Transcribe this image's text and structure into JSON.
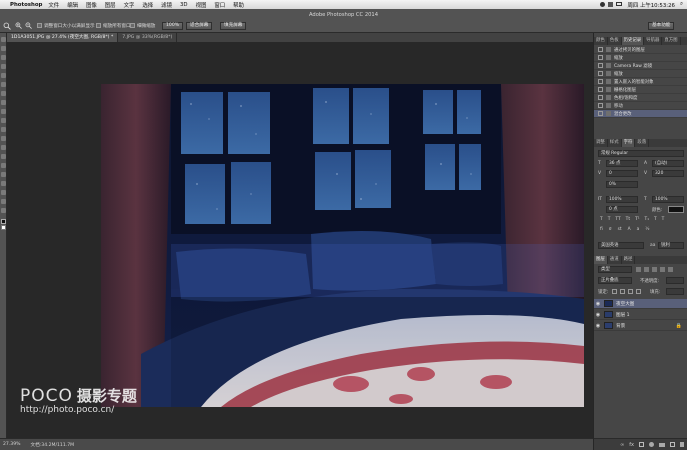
{
  "menubar": {
    "app_name": "Photoshop",
    "items": [
      "文件",
      "编辑",
      "图像",
      "图层",
      "文字",
      "选择",
      "滤镜",
      "3D",
      "视图",
      "窗口",
      "帮助"
    ],
    "clock": "周四 上午10:53:26",
    "search_glyph": "⌕"
  },
  "options_bar": {
    "window_title": "Adobe Photoshop CC 2014",
    "check_resize_windows": "调整窗口大小以满屏显示",
    "check_zoom_all": "缩放所有窗口",
    "check_scrubby_zoom": "细微缩放",
    "btn_100": "100%",
    "btn_fit_screen": "适合屏幕",
    "btn_fill_screen": "填充屏幕",
    "workspace": "基本功能"
  },
  "tabs": [
    {
      "label": "1D1A3051.JPG @ 27.4% (夜空大图, RGB/8*) *",
      "active": true
    },
    {
      "label": "7.JPG @ 33%(RGB/8*)",
      "active": false
    }
  ],
  "status": {
    "zoom": "27.39%",
    "doc": "文档:34.2M/111.7M"
  },
  "watermark": {
    "brand": "POCO",
    "title": "摄影专题",
    "url": "http://photo.poco.cn/"
  },
  "history_panel": {
    "tabs": [
      "颜色",
      "色板",
      "历史记录",
      "导航器",
      "直方图"
    ],
    "items": [
      {
        "label": "通过拷贝的图层",
        "selected": false
      },
      {
        "label": "缩放",
        "selected": false
      },
      {
        "label": "Camera Raw 滤镜",
        "selected": false
      },
      {
        "label": "缩放",
        "selected": false
      },
      {
        "label": "置入嵌入的智能对象",
        "selected": false
      },
      {
        "label": "栅格化图层",
        "selected": false
      },
      {
        "label": "色相/饱和度",
        "selected": false
      },
      {
        "label": "移动",
        "selected": false
      },
      {
        "label": "混合更改",
        "selected": true
      }
    ]
  },
  "character_panel": {
    "tabs": [
      "调整",
      "样式",
      "字符",
      "段落"
    ],
    "font_style": "常规 Regular",
    "size": "36 点",
    "leading": "(自动)",
    "kerning": "0",
    "tracking": "320",
    "scale_pct": "0%",
    "vscale": "100%",
    "hscale": "100%",
    "baseline": "0 点",
    "color_label": "颜色:",
    "language": "美国英语",
    "aa_label": "aa",
    "aa_mode": "锐利"
  },
  "layers_panel": {
    "tabs": [
      "图层",
      "通道",
      "路径"
    ],
    "filter": "类型",
    "blend_mode": "正片叠底",
    "opacity_label": "不透明度:",
    "lock_label": "锁定:",
    "fill_label": "填充:",
    "layers": [
      {
        "name": "夜空大图",
        "selected": true,
        "thumb": "#1b2a55"
      },
      {
        "name": "图层 1",
        "selected": false,
        "thumb": "#2a3c6a"
      },
      {
        "name": "背景",
        "selected": false,
        "thumb": "#2c3e6e"
      }
    ],
    "footer_icons": [
      "link-icon",
      "fx-icon",
      "mask-icon",
      "adjustment-icon",
      "folder-icon",
      "new-layer-icon",
      "trash-icon"
    ]
  }
}
